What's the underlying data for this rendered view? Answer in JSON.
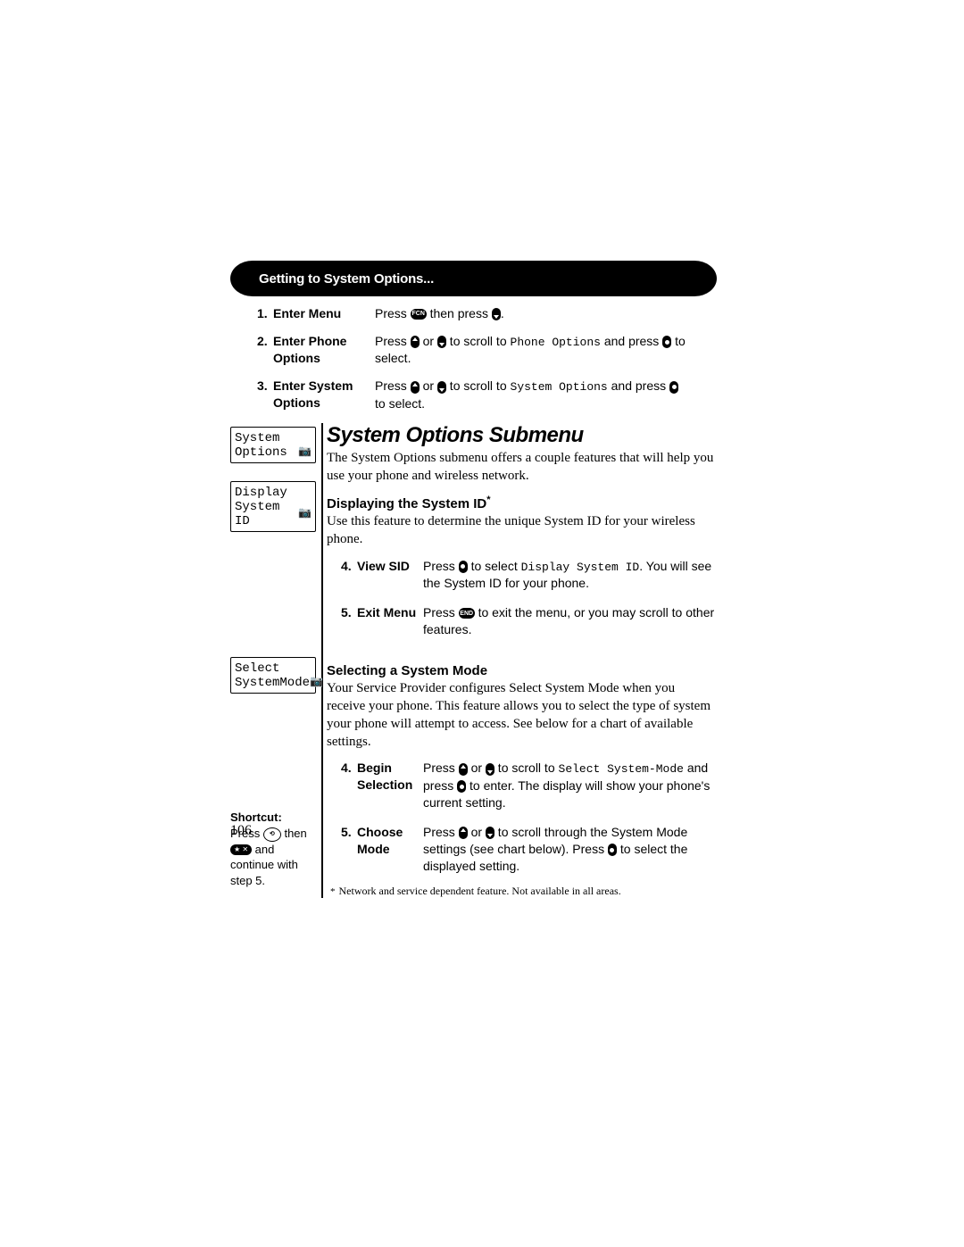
{
  "header": {
    "title": "Getting to System Options..."
  },
  "steps": [
    {
      "num": "1.",
      "label": "Enter Menu",
      "desc": [
        "Press ",
        {
          "icon": "fcn"
        },
        " then press ",
        {
          "icon": "down"
        },
        "."
      ]
    },
    {
      "num": "2.",
      "label": "Enter Phone Options",
      "desc": [
        "Press ",
        {
          "icon": "up"
        },
        " or ",
        {
          "icon": "down"
        },
        " to scroll to ",
        {
          "ocr": "Phone Options"
        },
        " and press ",
        {
          "icon": "dot"
        },
        " to select."
      ]
    },
    {
      "num": "3.",
      "label": "Enter System Options",
      "desc": [
        "Press ",
        {
          "icon": "up"
        },
        " or ",
        {
          "icon": "down"
        },
        " to scroll to ",
        {
          "ocr": "System Options"
        },
        " and press ",
        {
          "icon": "dot"
        },
        " to select."
      ]
    }
  ],
  "lcd_panels": [
    {
      "line1": "System",
      "line2_left": "Options",
      "line2_icon": "📷"
    },
    {
      "line1": "Display",
      "line2_left": "System ID",
      "line2_icon": "📷"
    },
    {
      "line1": "Select",
      "line2_left": "SystemMode",
      "line2_icon": "📷"
    }
  ],
  "main": {
    "title": "System Options Submenu",
    "intro": "The System Options submenu offers a couple features that will help you use your phone and wireless network.",
    "section1": {
      "heading": "Displaying the System ID",
      "star": "*",
      "body": "Use this feature to determine the unique System ID for your wireless phone.",
      "substeps": [
        {
          "num": "4.",
          "label": "View SID",
          "desc": [
            "Press ",
            {
              "icon": "dot"
            },
            " to select ",
            {
              "ocr": "Display System ID"
            },
            ". You will see the System ID for your phone."
          ]
        },
        {
          "num": "5.",
          "label": "Exit Menu",
          "desc": [
            "Press ",
            {
              "icon": "end"
            },
            " to exit the menu, or you may scroll to other features."
          ]
        }
      ]
    },
    "section2": {
      "heading": "Selecting a System Mode",
      "body": "Your Service Provider configures Select System Mode when you receive your phone. This feature allows you to select the type of system your phone will attempt to access. See below for a chart of available settings.",
      "substeps": [
        {
          "num": "4.",
          "label": "Begin Selection",
          "desc": [
            "Press ",
            {
              "icon": "up"
            },
            " or ",
            {
              "icon": "down"
            },
            " to scroll to ",
            {
              "ocr": "Select System-Mode"
            },
            " and press ",
            {
              "icon": "dot"
            },
            " to enter. The display will show your phone's current setting."
          ]
        },
        {
          "num": "5.",
          "label": "Choose Mode",
          "desc": [
            "Press ",
            {
              "icon": "up"
            },
            " or ",
            {
              "icon": "down"
            },
            " to scroll through the System Mode settings (see chart below). Press ",
            {
              "icon": "dot"
            },
            " to select the displayed setting."
          ]
        }
      ]
    }
  },
  "shortcut": {
    "title": "Shortcut:",
    "body": [
      "Press ",
      {
        "icon": "rcl"
      },
      " then ",
      {
        "icon": "starx"
      },
      " and continue with step 5."
    ]
  },
  "footnote": "Network and service dependent feature. Not available in all areas.",
  "page_number": "106",
  "icon_labels": {
    "fcn": "FCN",
    "end": "END",
    "rcl": "⟲",
    "starx": "★ ✕"
  }
}
